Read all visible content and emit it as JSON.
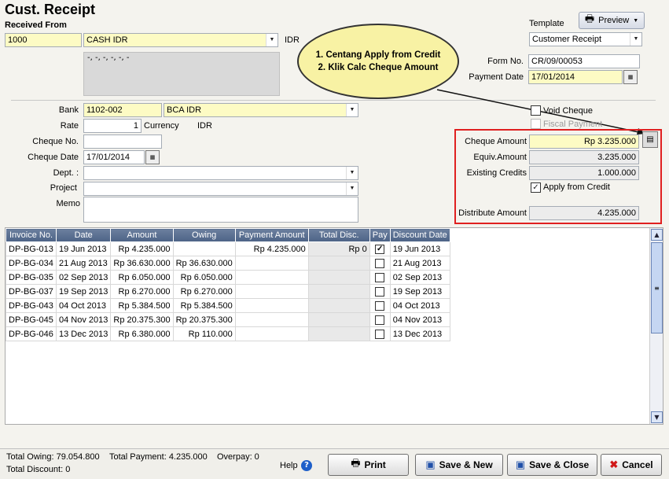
{
  "header": {
    "title": "Cust. Receipt",
    "received_from_label": "Received From",
    "customer_code": "1000",
    "customer_name": "CASH IDR",
    "currency": "IDR",
    "address": "-, -, -, -, -, -",
    "template_label": "Template",
    "preview_label": "Preview",
    "template_value": "Customer Receipt",
    "form_no_label": "Form No.",
    "form_no": "CR/09/00053",
    "payment_date_label": "Payment Date",
    "payment_date": "17/01/2014"
  },
  "annotation": {
    "line1": "1. Centang Apply from Credit",
    "line2": "2. Klik Calc Cheque Amount"
  },
  "form": {
    "bank_label": "Bank",
    "bank_code": "1102-002",
    "bank_name": "BCA IDR",
    "rate_label": "Rate",
    "rate": "1",
    "currency_label": "Currency",
    "currency_value": "IDR",
    "cheque_no_label": "Cheque No.",
    "cheque_no": "",
    "cheque_date_label": "Cheque Date",
    "cheque_date": "17/01/2014",
    "dept_label": "Dept. :",
    "project_label": "Project",
    "memo_label": "Memo",
    "void_cheque_label": "Void Cheque",
    "fiscal_payment_label": "Fiscal Payment"
  },
  "amounts": {
    "cheque_amount_label": "Cheque Amount",
    "cheque_amount": "Rp 3.235.000",
    "equiv_amount_label": "Equiv.Amount",
    "equiv_amount": "3.235.000",
    "existing_credits_label": "Existing Credits",
    "existing_credits": "1.000.000",
    "apply_from_credit_label": "Apply from Credit",
    "distribute_amount_label": "Distribute Amount",
    "distribute_amount": "4.235.000"
  },
  "grid": {
    "columns": [
      "Invoice No.",
      "Date",
      "Amount",
      "Owing",
      "Payment Amount",
      "Total Disc.",
      "Pay",
      "Discount Date"
    ],
    "rows": [
      {
        "invoice": "DP-BG-013",
        "date": "19 Jun 2013",
        "amount": "Rp 4.235.000",
        "owing": "",
        "payment": "Rp 4.235.000",
        "disc": "Rp 0",
        "pay": true,
        "disc_date": "19 Jun 2013"
      },
      {
        "invoice": "DP-BG-034",
        "date": "21 Aug 2013",
        "amount": "Rp 36.630.000",
        "owing": "Rp 36.630.000",
        "payment": "",
        "disc": "",
        "pay": false,
        "disc_date": "21 Aug 2013"
      },
      {
        "invoice": "DP-BG-035",
        "date": "02 Sep 2013",
        "amount": "Rp 6.050.000",
        "owing": "Rp 6.050.000",
        "payment": "",
        "disc": "",
        "pay": false,
        "disc_date": "02 Sep 2013"
      },
      {
        "invoice": "DP-BG-037",
        "date": "19 Sep 2013",
        "amount": "Rp 6.270.000",
        "owing": "Rp 6.270.000",
        "payment": "",
        "disc": "",
        "pay": false,
        "disc_date": "19 Sep 2013"
      },
      {
        "invoice": "DP-BG-043",
        "date": "04 Oct 2013",
        "amount": "Rp 5.384.500",
        "owing": "Rp 5.384.500",
        "payment": "",
        "disc": "",
        "pay": false,
        "disc_date": "04 Oct 2013"
      },
      {
        "invoice": "DP-BG-045",
        "date": "04 Nov 2013",
        "amount": "Rp 20.375.300",
        "owing": "Rp 20.375.300",
        "payment": "",
        "disc": "",
        "pay": false,
        "disc_date": "04 Nov 2013"
      },
      {
        "invoice": "DP-BG-046",
        "date": "13 Dec 2013",
        "amount": "Rp 6.380.000",
        "owing": "Rp 110.000",
        "payment": "",
        "disc": "",
        "pay": false,
        "disc_date": "13 Dec 2013"
      }
    ]
  },
  "footer": {
    "total_owing": "Total Owing: 79.054.800",
    "total_payment": "Total Payment: 4.235.000",
    "overpay": "Overpay: 0",
    "total_discount": "Total Discount: 0",
    "help_label": "Help",
    "print_label": "Print",
    "save_new_label": "Save & New",
    "save_close_label": "Save & Close",
    "cancel_label": "Cancel"
  },
  "colors": {
    "field_yellow": "#fdfbc4",
    "grid_header": "#5a6f92",
    "highlight_red": "#e02020",
    "bubble_fill": "#f8f2a4"
  }
}
